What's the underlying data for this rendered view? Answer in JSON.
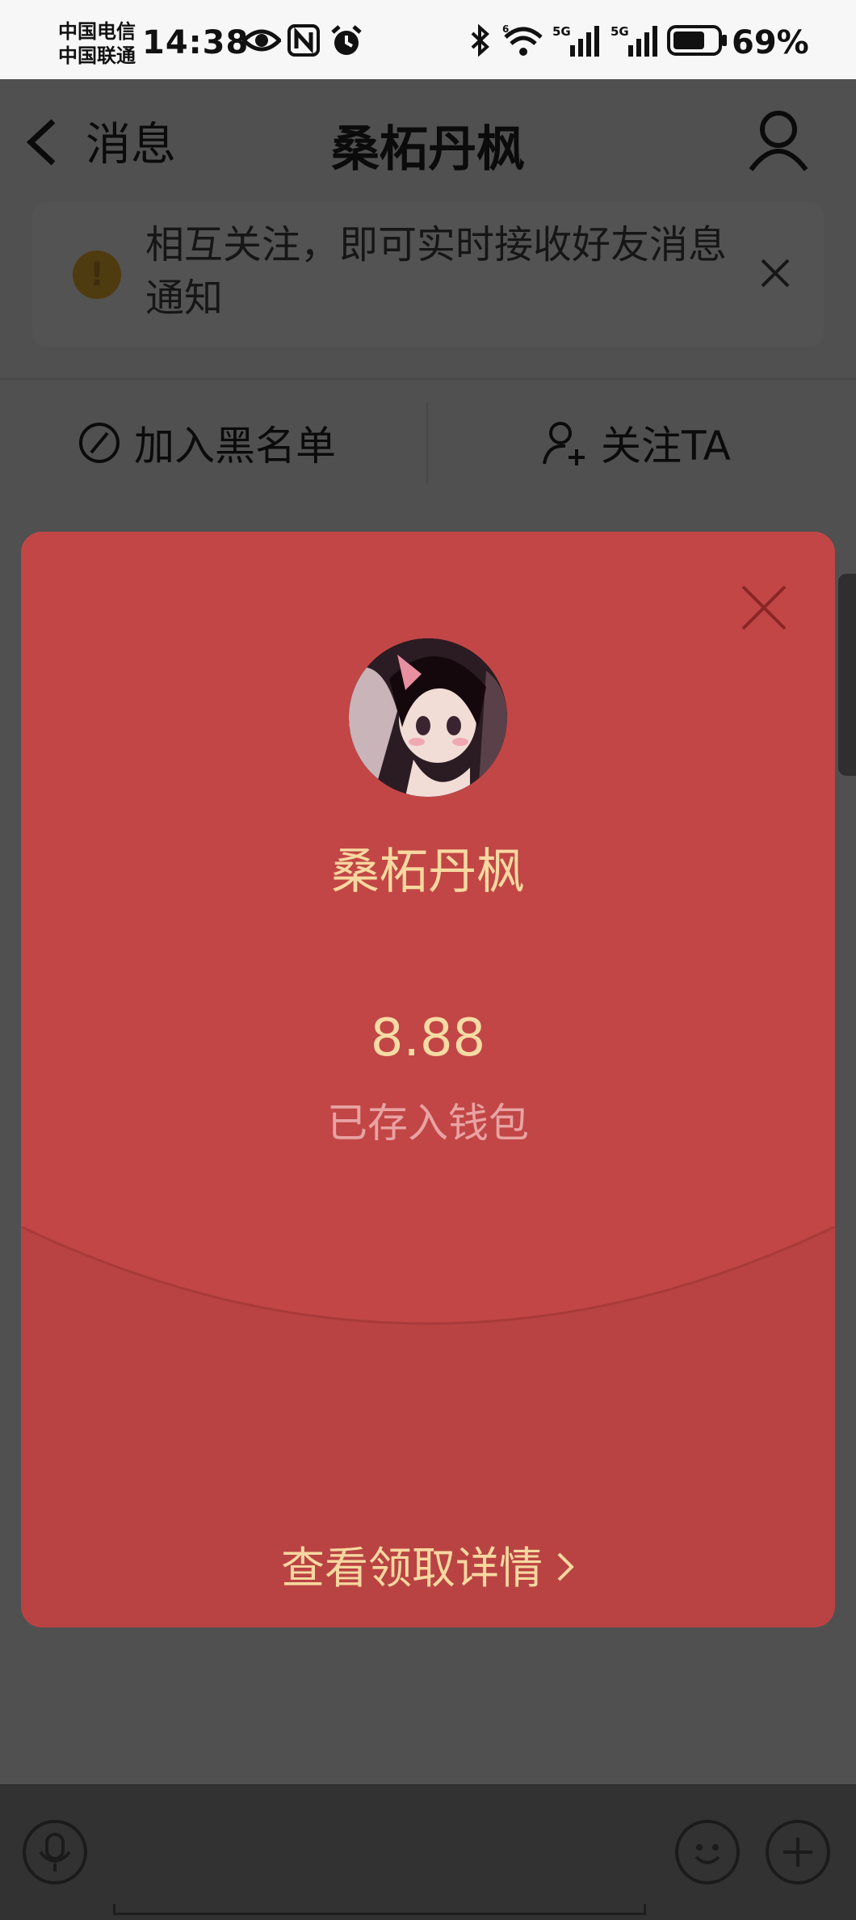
{
  "status_bar": {
    "carrier_1": "中国电信",
    "carrier_2": "中国联通",
    "time": "14:38",
    "battery_percent": "69%",
    "network_1": "5G",
    "network_2": "5G",
    "wifi_label": "6"
  },
  "navbar": {
    "back_label": "消息",
    "title": "桑柘丹枫"
  },
  "notice": {
    "text": "相互关注，即可实时接收好友消息通知"
  },
  "actions": {
    "blacklist_label": "加入黑名单",
    "follow_label": "关注TA"
  },
  "red_packet": {
    "sender_name": "桑柘丹枫",
    "amount": "8.88",
    "status": "已存入钱包",
    "details_link": "查看领取详情",
    "colors": {
      "card_top": "#c24646",
      "card_bottom": "#b94343",
      "gold_text": "#f7d8a0"
    }
  },
  "icons": {
    "back": "chevron-left-icon",
    "profile": "user-icon",
    "close": "close-icon",
    "warning": "warning-icon",
    "block": "block-icon",
    "add_user": "add-user-icon",
    "voice": "microphone-icon",
    "emoji": "smiley-icon",
    "more": "plus-icon"
  }
}
